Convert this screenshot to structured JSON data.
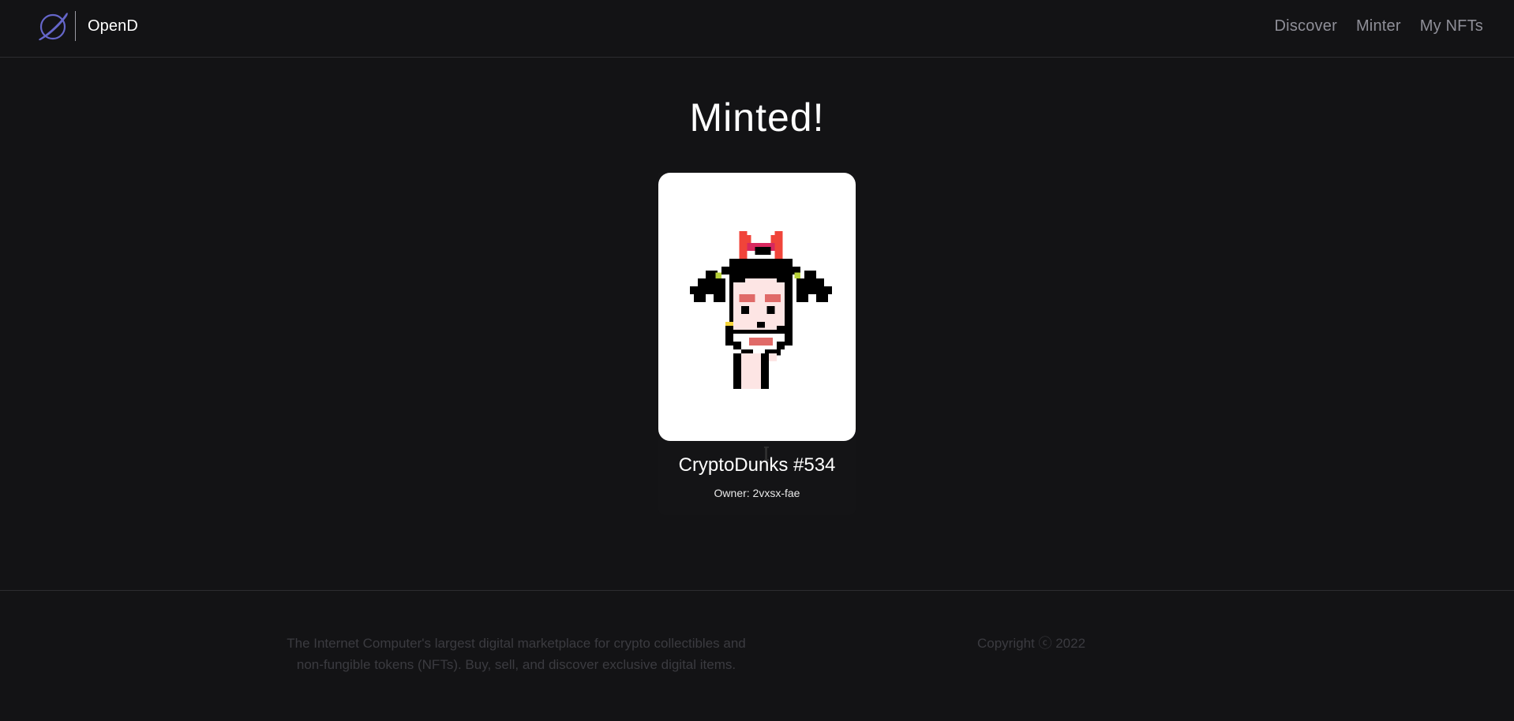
{
  "header": {
    "brand_name": "OpenD",
    "nav": {
      "discover": "Discover",
      "minter": "Minter",
      "my_nfts": "My NFTs"
    }
  },
  "main": {
    "title": "Minted!",
    "nft": {
      "name": "CryptoDunks #534",
      "owner": "Owner: 2vxsx-fae"
    }
  },
  "footer": {
    "about": "The Internet Computer's largest digital marketplace for crypto collectibles and non-fungible tokens (NFTs). Buy, sell, and discover exclusive digital items.",
    "copyright": "Copyright ⓒ 2022"
  },
  "icons": {
    "logo": "planet-logo-icon",
    "cursor": "text-cursor-icon"
  },
  "colors": {
    "background": "#131315",
    "logo_accent": "#6566c9",
    "nav_text": "#8f8f98",
    "footer_text": "#3b3b40"
  }
}
